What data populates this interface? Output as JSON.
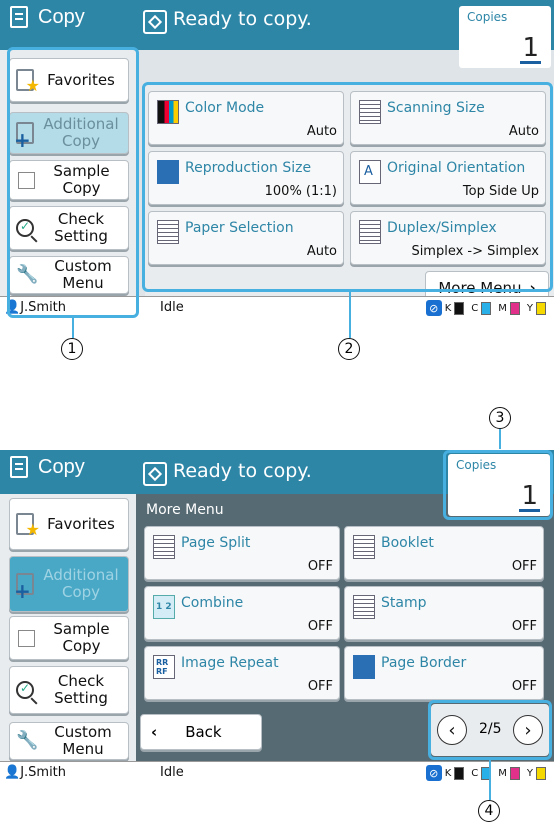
{
  "app_title": "Copy",
  "status_text": "Ready to copy.",
  "copies": {
    "label": "Copies",
    "value": "1"
  },
  "sidebar": {
    "favorites": "Favorites",
    "additional_copy": "Additional Copy",
    "sample_copy": "Sample Copy",
    "check_setting": "Check Setting",
    "custom_menu": "Custom Menu"
  },
  "functions": [
    {
      "name": "Color Mode",
      "value": "Auto",
      "icon": "color-mode-icon"
    },
    {
      "name": "Scanning Size",
      "value": "Auto",
      "icon": "scanning-size-icon"
    },
    {
      "name": "Reproduction Size",
      "value": "100% (1:1)",
      "icon": "reproduction-size-icon"
    },
    {
      "name": "Original Orientation",
      "value": "Top Side Up",
      "icon": "orientation-icon"
    },
    {
      "name": "Paper Selection",
      "value": "Auto",
      "icon": "paper-tray-icon"
    },
    {
      "name": "Duplex/Simplex",
      "value": "Simplex -> Simplex",
      "icon": "duplex-icon"
    }
  ],
  "more_menu_label": "More Menu",
  "more_functions": [
    {
      "name": "Page Split",
      "value": "OFF",
      "icon": "page-split-icon"
    },
    {
      "name": "Booklet",
      "value": "OFF",
      "icon": "booklet-icon"
    },
    {
      "name": "Combine",
      "value": "OFF",
      "icon": "combine-icon"
    },
    {
      "name": "Stamp",
      "value": "OFF",
      "icon": "stamp-icon"
    },
    {
      "name": "Image Repeat",
      "value": "OFF",
      "icon": "image-repeat-icon"
    },
    {
      "name": "Page Border",
      "value": "OFF",
      "icon": "page-border-icon"
    }
  ],
  "more_menu_header": "More Menu",
  "back_label": "Back",
  "page_indicator": "2/5",
  "footer": {
    "user": "J.Smith",
    "state": "Idle",
    "inks": [
      "K",
      "C",
      "M",
      "Y"
    ]
  },
  "callouts": [
    "1",
    "2",
    "3",
    "4"
  ],
  "colors": {
    "bar": "#2e86a7",
    "highlight": "#47b0e0"
  }
}
